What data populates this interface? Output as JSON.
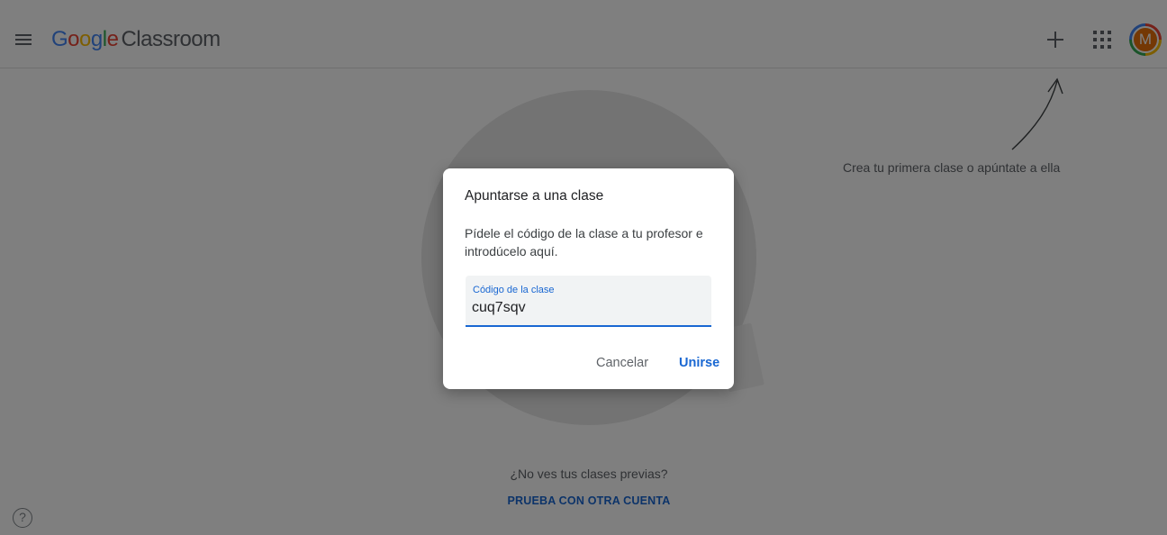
{
  "header": {
    "logo_google": [
      "G",
      "o",
      "o",
      "g",
      "l",
      "e"
    ],
    "logo_product": "Classroom",
    "avatar_initial": "M"
  },
  "empty_state": {
    "hint": "Crea tu primera clase o apúntate a ella",
    "previous_classes_text": "¿No ves tus clases previas?",
    "try_another_account": "PRUEBA CON OTRA CUENTA"
  },
  "help": {
    "label": "?"
  },
  "dialog": {
    "title": "Apuntarse a una clase",
    "description": "Pídele el código de la clase a tu profesor e introdúcelo aquí.",
    "field_label": "Código de la clase",
    "field_value": "cuq7sqv",
    "cancel_label": "Cancelar",
    "join_label": "Unirse"
  },
  "colors": {
    "accent": "#1967d2",
    "avatar_bg": "#e8710a"
  },
  "icons": [
    "menu-icon",
    "plus-icon",
    "apps-grid-icon",
    "help-icon",
    "arrow-icon"
  ]
}
